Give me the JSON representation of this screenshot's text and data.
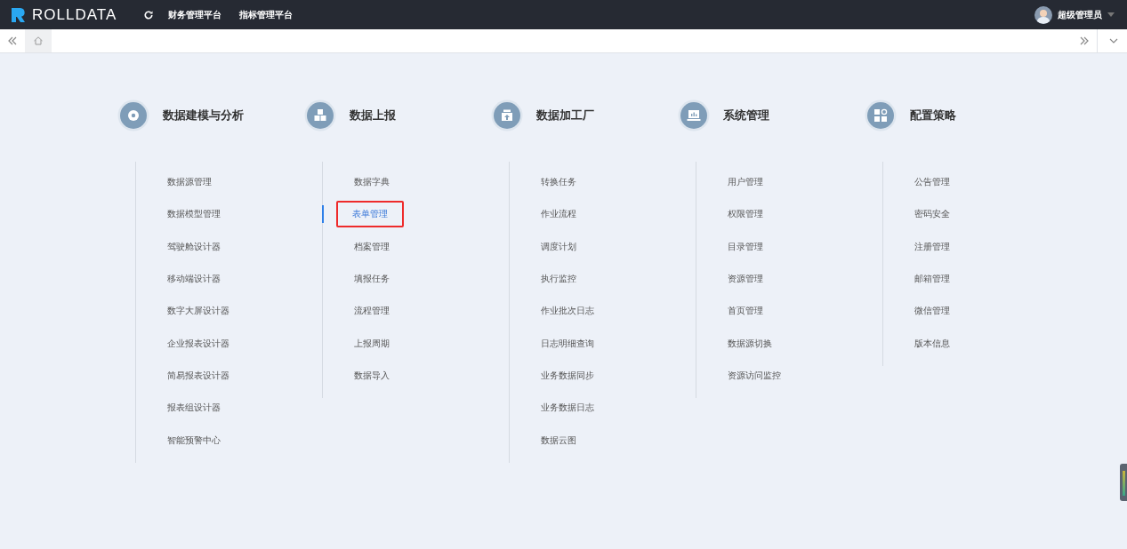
{
  "header": {
    "brand": "ROLLDATA",
    "nav": [
      "财务管理平台",
      "指标管理平台"
    ],
    "user": "超级管理员"
  },
  "groups": [
    {
      "title": "数据建模与分析",
      "items": [
        {
          "label": "数据源管理",
          "selected": false
        },
        {
          "label": "数据模型管理",
          "selected": false
        },
        {
          "label": "驾驶舱设计器",
          "selected": false
        },
        {
          "label": "移动端设计器",
          "selected": false
        },
        {
          "label": "数字大屏设计器",
          "selected": false
        },
        {
          "label": "企业报表设计器",
          "selected": false
        },
        {
          "label": "简易报表设计器",
          "selected": false
        },
        {
          "label": "报表组设计器",
          "selected": false
        },
        {
          "label": "智能预警中心",
          "selected": false
        }
      ]
    },
    {
      "title": "数据上报",
      "items": [
        {
          "label": "数据字典",
          "selected": false
        },
        {
          "label": "表单管理",
          "selected": true
        },
        {
          "label": "档案管理",
          "selected": false
        },
        {
          "label": "填报任务",
          "selected": false
        },
        {
          "label": "流程管理",
          "selected": false
        },
        {
          "label": "上报周期",
          "selected": false
        },
        {
          "label": "数据导入",
          "selected": false
        }
      ]
    },
    {
      "title": "数据加工厂",
      "items": [
        {
          "label": "转换任务",
          "selected": false
        },
        {
          "label": "作业流程",
          "selected": false
        },
        {
          "label": "调度计划",
          "selected": false
        },
        {
          "label": "执行监控",
          "selected": false
        },
        {
          "label": "作业批次日志",
          "selected": false
        },
        {
          "label": "日志明细查询",
          "selected": false
        },
        {
          "label": "业务数据同步",
          "selected": false
        },
        {
          "label": "业务数据日志",
          "selected": false
        },
        {
          "label": "数据云图",
          "selected": false
        }
      ]
    },
    {
      "title": "系统管理",
      "items": [
        {
          "label": "用户管理",
          "selected": false
        },
        {
          "label": "权限管理",
          "selected": false
        },
        {
          "label": "目录管理",
          "selected": false
        },
        {
          "label": "资源管理",
          "selected": false
        },
        {
          "label": "首页管理",
          "selected": false
        },
        {
          "label": "数据源切换",
          "selected": false
        },
        {
          "label": "资源访问监控",
          "selected": false
        }
      ]
    },
    {
      "title": "配置策略",
      "items": [
        {
          "label": "公告管理",
          "selected": false
        },
        {
          "label": "密码安全",
          "selected": false
        },
        {
          "label": "注册管理",
          "selected": false
        },
        {
          "label": "邮箱管理",
          "selected": false
        },
        {
          "label": "微信管理",
          "selected": false
        },
        {
          "label": "版本信息",
          "selected": false
        }
      ]
    }
  ]
}
